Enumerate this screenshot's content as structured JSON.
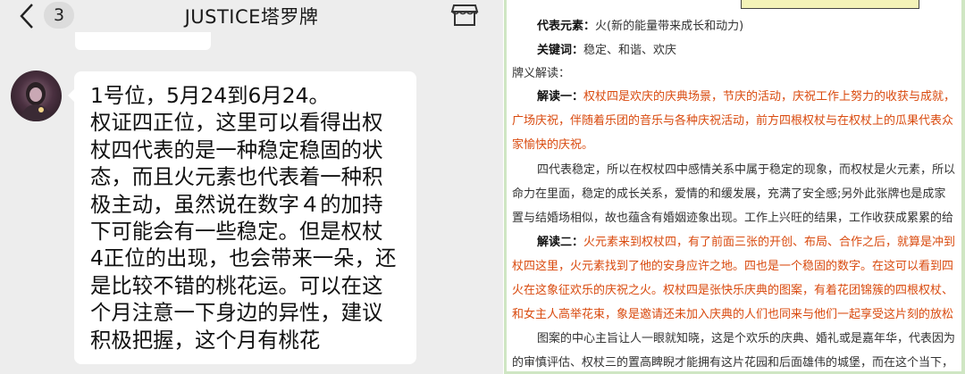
{
  "chat": {
    "unread_count": "3",
    "title": "JUSTICE塔罗牌",
    "message_lines": [
      "1号位，5月24到6月24。",
      "权证四正位，这里可以看得出权",
      "杖四代表的是一种稳定稳固的状",
      "态，而且火元素也代表着一种积",
      "极主动，虽然说在数字４的加持",
      "下可能会有一些稳定。但是权杖",
      "4正位的出现，也会带来一朵，还",
      "是比较不错的桃花运。可以在这",
      "个月注意一下身边的异性，建议",
      "积极把握，这个月有桃花"
    ]
  },
  "doc": {
    "element_label": "代表元素：",
    "element_value": "火(新的能量带来成长和动力)",
    "keywords_label": "关键词：",
    "keywords_value": "稳定、和谐、欢庆",
    "meaning_heading": "牌义解读：",
    "reading1_label": "解读一：",
    "reading1_l1": "权杖四是欢庆的庆典场景，节庆的活动，庆祝工作上努力的收获与成就，",
    "reading1_l2": "广场庆祝，伴随着乐团的音乐与各种庆祝活动，前方四根权杖与在权杖上的瓜果代表众",
    "reading1_l3": "家愉快的庆祝。",
    "para2_l1": "四代表稳定，所以在权杖四中感情关系中属于稳定的现象，而权杖是火元素，所以",
    "para2_l2": "命力在里面，稳定的成长关系，爱情的和缓发展，充满了安全感;另外此张牌也是成家",
    "para2_l3": "置与结婚场相似，故也蕴含有婚姻迹象出现。工作上兴旺的结果，工作收获成累累的给",
    "reading2_label": "解读二：",
    "reading2_l1": "火元素来到权杖四，有了前面三张的开创、布局、合作之后，就算是冲到",
    "reading2_l2": "杖四这里，火元素找到了他的安身应许之地。四也是一个稳固的数字。在这可以看到四",
    "reading2_l3": "火在这象征欢乐的庆祝之火。权杖四是张快乐庆典的图案，有着花团锦簇的四根权杖、",
    "reading2_l4": "和女主人高举花束，象是邀请还未加入庆典的人们也同来与他们一起享受这片刻的放松",
    "para4_l1": "图案的中心主旨让人一眼就知晓，这是个欢乐的庆典、婚礼或是嘉年华，代表因为",
    "para4_l2": "的审慎评估、权杖三的置高睥睨才能拥有这片花园和后面雄伟的城堡，而在这个当下，"
  }
}
